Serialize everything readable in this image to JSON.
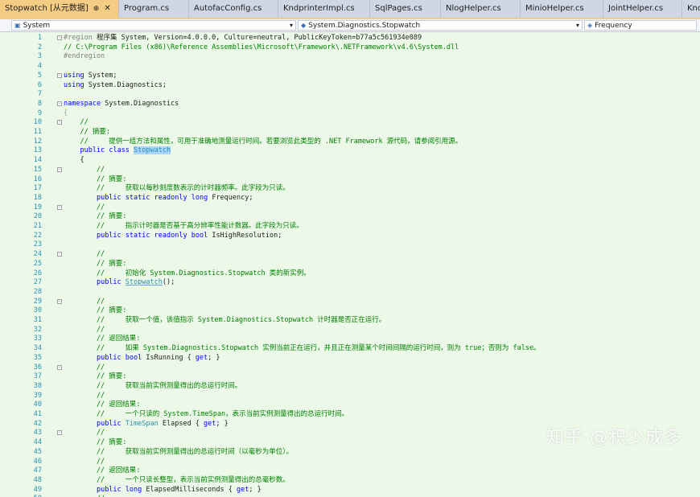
{
  "tabs": [
    {
      "label": "Stopwatch [从元数据]",
      "active": true,
      "pin": "⊕",
      "close": "✕"
    },
    {
      "label": "Program.cs"
    },
    {
      "label": "AutofacConfig.cs"
    },
    {
      "label": "KndprinterImpl.cs"
    },
    {
      "label": "SqlPages.cs"
    },
    {
      "label": "NlogHelper.cs"
    },
    {
      "label": "MinioHelper.cs"
    },
    {
      "label": "JointHelper.cs"
    },
    {
      "label": "Knd"
    }
  ],
  "navbar": {
    "project": "System",
    "type": "System.Diagnostics.Stopwatch",
    "member": "Frequency"
  },
  "colors": {
    "accent_tab": "#f5cc84",
    "editor_bg": "#ecf8e8",
    "keyword": "#0000ff",
    "comment": "#008000",
    "type": "#2b91af",
    "line_number": "#2b91af"
  },
  "icons": {
    "project": "csharp-project-icon",
    "type": "class-icon",
    "member": "field-icon",
    "pin": "pin-icon",
    "close": "close-icon",
    "dropdown": "chevron-down-icon",
    "fold": "fold-toggle-icon"
  },
  "code_lines": [
    {
      "n": "1",
      "fold": "-",
      "tokens": [
        {
          "t": "#region ",
          "c": "rg"
        },
        {
          "t": "程序集 System, Version=4.0.0.0, Culture=neutral, PublicKeyToken=b77a5c561934e089"
        }
      ]
    },
    {
      "n": "2",
      "tokens": [
        {
          "t": "// C:\\Program Files (x86)\\Reference Assemblies\\Microsoft\\Framework\\.NETFramework\\v4.6\\System.dll",
          "c": "cm"
        }
      ]
    },
    {
      "n": "3",
      "tokens": [
        {
          "t": "#endregion",
          "c": "rg"
        }
      ]
    },
    {
      "n": "4",
      "tokens": []
    },
    {
      "n": "5",
      "fold": "-",
      "tokens": [
        {
          "t": "using",
          "c": "kw"
        },
        {
          "t": " System;"
        }
      ]
    },
    {
      "n": "6",
      "tokens": [
        {
          "t": "using",
          "c": "kw"
        },
        {
          "t": " System.Diagnostics;"
        }
      ]
    },
    {
      "n": "7",
      "tokens": []
    },
    {
      "n": "8",
      "fold": "-",
      "tokens": [
        {
          "t": "namespace",
          "c": "kw"
        },
        {
          "t": " System.Diagnostics"
        }
      ]
    },
    {
      "n": "9",
      "tokens": [
        {
          "t": "{",
          "c": "gl"
        }
      ]
    },
    {
      "n": "10",
      "fold": "-",
      "tokens": [
        {
          "t": "    //",
          "c": "cm"
        }
      ]
    },
    {
      "n": "11",
      "tokens": [
        {
          "t": "    // 摘要:",
          "c": "cm"
        }
      ]
    },
    {
      "n": "12",
      "tokens": [
        {
          "t": "    //     提供一组方法和属性，可用于准确地测量运行时间。若要浏览此类型的 .NET Framework 源代码，请参阅引用源。",
          "c": "cm"
        }
      ]
    },
    {
      "n": "13",
      "tokens": [
        {
          "t": "    "
        },
        {
          "t": "public",
          "c": "kw"
        },
        {
          "t": " "
        },
        {
          "t": "class",
          "c": "kw"
        },
        {
          "t": " "
        },
        {
          "t": "Stopwatch",
          "c": "hl"
        }
      ]
    },
    {
      "n": "14",
      "tokens": [
        {
          "t": "    {"
        }
      ]
    },
    {
      "n": "15",
      "fold": "-",
      "tokens": [
        {
          "t": "        //",
          "c": "cm"
        }
      ]
    },
    {
      "n": "16",
      "tokens": [
        {
          "t": "        // 摘要:",
          "c": "cm"
        }
      ]
    },
    {
      "n": "17",
      "tokens": [
        {
          "t": "        //     获取以每秒刻度数表示的计时器频率。此字段为只读。",
          "c": "cm"
        }
      ]
    },
    {
      "n": "18",
      "tokens": [
        {
          "t": "        "
        },
        {
          "t": "public",
          "c": "kw"
        },
        {
          "t": " "
        },
        {
          "t": "static",
          "c": "kw"
        },
        {
          "t": " "
        },
        {
          "t": "readonly",
          "c": "kw"
        },
        {
          "t": " "
        },
        {
          "t": "long",
          "c": "kw"
        },
        {
          "t": " Frequency;"
        }
      ]
    },
    {
      "n": "19",
      "fold": "-",
      "tokens": [
        {
          "t": "        //",
          "c": "cm"
        }
      ]
    },
    {
      "n": "20",
      "tokens": [
        {
          "t": "        // 摘要:",
          "c": "cm"
        }
      ]
    },
    {
      "n": "21",
      "tokens": [
        {
          "t": "        //     指示计时器是否基于高分辨率性能计数器。此字段为只读。",
          "c": "cm"
        }
      ]
    },
    {
      "n": "22",
      "tokens": [
        {
          "t": "        "
        },
        {
          "t": "public",
          "c": "kw"
        },
        {
          "t": " "
        },
        {
          "t": "static",
          "c": "kw"
        },
        {
          "t": " "
        },
        {
          "t": "readonly",
          "c": "kw"
        },
        {
          "t": " "
        },
        {
          "t": "bool",
          "c": "kw"
        },
        {
          "t": " IsHighResolution;"
        }
      ]
    },
    {
      "n": "23",
      "tokens": []
    },
    {
      "n": "24",
      "fold": "-",
      "tokens": [
        {
          "t": "        //",
          "c": "cm"
        }
      ]
    },
    {
      "n": "25",
      "tokens": [
        {
          "t": "        // 摘要:",
          "c": "cm"
        }
      ]
    },
    {
      "n": "26",
      "tokens": [
        {
          "t": "        //     初始化 System.Diagnostics.Stopwatch 类的新实例。",
          "c": "cm"
        }
      ]
    },
    {
      "n": "27",
      "tokens": [
        {
          "t": "        "
        },
        {
          "t": "public",
          "c": "kw"
        },
        {
          "t": " "
        },
        {
          "t": "Stopwatch",
          "c": "ul"
        },
        {
          "t": "();"
        }
      ]
    },
    {
      "n": "28",
      "tokens": []
    },
    {
      "n": "29",
      "fold": "-",
      "tokens": [
        {
          "t": "        //",
          "c": "cm"
        }
      ]
    },
    {
      "n": "30",
      "tokens": [
        {
          "t": "        // 摘要:",
          "c": "cm"
        }
      ]
    },
    {
      "n": "31",
      "tokens": [
        {
          "t": "        //     获取一个值，该值指示 System.Diagnostics.Stopwatch 计时器是否正在运行。",
          "c": "cm"
        }
      ]
    },
    {
      "n": "32",
      "tokens": [
        {
          "t": "        //",
          "c": "cm"
        }
      ]
    },
    {
      "n": "33",
      "tokens": [
        {
          "t": "        // 返回结果:",
          "c": "cm"
        }
      ]
    },
    {
      "n": "34",
      "tokens": [
        {
          "t": "        //     如果 System.Diagnostics.Stopwatch 实例当前正在运行，并且正在测量某个时间间隔的运行时间，则为 true；否则为 false。",
          "c": "cm"
        }
      ]
    },
    {
      "n": "35",
      "tokens": [
        {
          "t": "        "
        },
        {
          "t": "public",
          "c": "kw"
        },
        {
          "t": " "
        },
        {
          "t": "bool",
          "c": "kw"
        },
        {
          "t": " IsRunning { "
        },
        {
          "t": "get",
          "c": "kw"
        },
        {
          "t": "; }"
        }
      ]
    },
    {
      "n": "36",
      "fold": "-",
      "tokens": [
        {
          "t": "        //",
          "c": "cm"
        }
      ]
    },
    {
      "n": "37",
      "tokens": [
        {
          "t": "        // 摘要:",
          "c": "cm"
        }
      ]
    },
    {
      "n": "38",
      "tokens": [
        {
          "t": "        //     获取当前实例测量得出的总运行时间。",
          "c": "cm"
        }
      ]
    },
    {
      "n": "39",
      "tokens": [
        {
          "t": "        //",
          "c": "cm"
        }
      ]
    },
    {
      "n": "40",
      "tokens": [
        {
          "t": "        // 返回结果:",
          "c": "cm"
        }
      ]
    },
    {
      "n": "41",
      "tokens": [
        {
          "t": "        //     一个只读的 System.TimeSpan，表示当前实例测量得出的总运行时间。",
          "c": "cm"
        }
      ]
    },
    {
      "n": "42",
      "tokens": [
        {
          "t": "        "
        },
        {
          "t": "public",
          "c": "kw"
        },
        {
          "t": " "
        },
        {
          "t": "TimeSpan",
          "c": "tp"
        },
        {
          "t": " Elapsed { "
        },
        {
          "t": "get",
          "c": "kw"
        },
        {
          "t": "; }"
        }
      ]
    },
    {
      "n": "43",
      "fold": "-",
      "tokens": [
        {
          "t": "        //",
          "c": "cm"
        }
      ]
    },
    {
      "n": "44",
      "tokens": [
        {
          "t": "        // 摘要:",
          "c": "cm"
        }
      ]
    },
    {
      "n": "45",
      "tokens": [
        {
          "t": "        //     获取当前实例测量得出的总运行时间（以毫秒为单位）。",
          "c": "cm"
        }
      ]
    },
    {
      "n": "46",
      "tokens": [
        {
          "t": "        //",
          "c": "cm"
        }
      ]
    },
    {
      "n": "47",
      "tokens": [
        {
          "t": "        // 返回结果:",
          "c": "cm"
        }
      ]
    },
    {
      "n": "48",
      "tokens": [
        {
          "t": "        //     一个只读长整型，表示当前实例测量得出的总毫秒数。",
          "c": "cm"
        }
      ]
    },
    {
      "n": "49",
      "tokens": [
        {
          "t": "        "
        },
        {
          "t": "public",
          "c": "kw"
        },
        {
          "t": " "
        },
        {
          "t": "long",
          "c": "kw"
        },
        {
          "t": " ElapsedMilliseconds { "
        },
        {
          "t": "get",
          "c": "kw"
        },
        {
          "t": "; }"
        }
      ]
    },
    {
      "n": "50",
      "tokens": [
        {
          "t": "        //",
          "c": "cm"
        }
      ]
    }
  ],
  "watermark": "知乎 @积少成多"
}
